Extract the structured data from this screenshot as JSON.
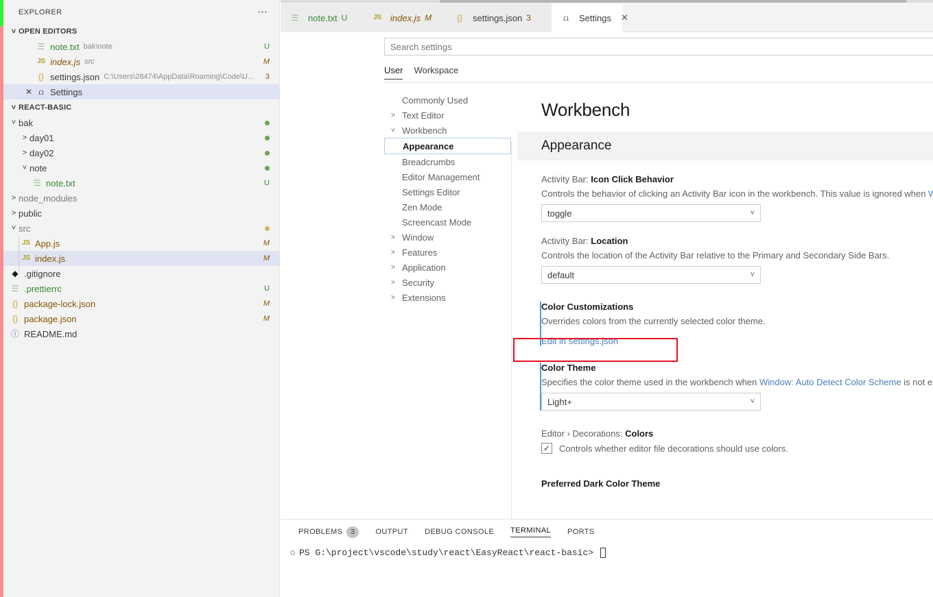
{
  "sidebar": {
    "title": "EXPLORER",
    "more_icon": "ellipsis-icon",
    "open_editors": {
      "label": "OPEN EDITORS",
      "items": [
        {
          "icon": "text-file-icon",
          "name": "note.txt",
          "sub": "bak\\note",
          "badge": "U",
          "badge_kind": "u"
        },
        {
          "icon": "js-file-icon",
          "name": "index.js",
          "sub": "src",
          "badge": "M",
          "badge_kind": "m"
        },
        {
          "icon": "json-file-icon",
          "name": "settings.json",
          "sub": "C:\\Users\\28474\\AppData\\Roaming\\Code\\U...",
          "badge": "3",
          "badge_kind": "n"
        },
        {
          "icon": "settings-gear-icon",
          "name": "Settings",
          "sub": "",
          "badge": "",
          "badge_kind": ""
        }
      ]
    },
    "project": {
      "label": "REACT-BASIC",
      "items": [
        {
          "name": "bak",
          "kind": "folder",
          "expanded": true,
          "depth": 1,
          "decor": "dot-green"
        },
        {
          "name": "day01",
          "kind": "folder",
          "expanded": false,
          "depth": 2,
          "decor": "dot-green"
        },
        {
          "name": "day02",
          "kind": "folder",
          "expanded": false,
          "depth": 2,
          "decor": "dot-green"
        },
        {
          "name": "note",
          "kind": "folder",
          "expanded": true,
          "depth": 2,
          "decor": "dot-green"
        },
        {
          "name": "note.txt",
          "kind": "txt",
          "depth": 3,
          "badge": "U",
          "badge_kind": "u"
        },
        {
          "name": "node_modules",
          "kind": "folder",
          "expanded": false,
          "depth": 1,
          "dim": true
        },
        {
          "name": "public",
          "kind": "folder",
          "expanded": false,
          "depth": 1
        },
        {
          "name": "src",
          "kind": "folder",
          "expanded": true,
          "depth": 1,
          "decor": "dot-tan",
          "dim": true
        },
        {
          "name": "App.js",
          "kind": "js",
          "depth": 2,
          "badge": "M",
          "badge_kind": "m"
        },
        {
          "name": "index.js",
          "kind": "js",
          "depth": 2,
          "badge": "M",
          "badge_kind": "m",
          "selected": true
        },
        {
          "name": ".gitignore",
          "kind": "git",
          "depth": 1
        },
        {
          "name": ".prettierrc",
          "kind": "txt",
          "depth": 1,
          "badge": "U",
          "badge_kind": "u"
        },
        {
          "name": "package-lock.json",
          "kind": "json",
          "depth": 1,
          "badge": "M",
          "badge_kind": "m"
        },
        {
          "name": "package.json",
          "kind": "json",
          "depth": 1,
          "badge": "M",
          "badge_kind": "m"
        },
        {
          "name": "README.md",
          "kind": "md",
          "depth": 1
        }
      ]
    }
  },
  "tabs": [
    {
      "icon": "text-file-icon",
      "label": "note.txt",
      "badge": "U",
      "badge_kind": "u",
      "active": false
    },
    {
      "icon": "js-file-icon",
      "label": "index.js",
      "badge": "M",
      "badge_kind": "m",
      "active": false
    },
    {
      "icon": "json-file-icon",
      "label": "settings.json",
      "badge": "3",
      "badge_kind": "n",
      "active": false
    },
    {
      "icon": "settings-gear-icon",
      "label": "Settings",
      "badge": "",
      "badge_kind": "",
      "active": true,
      "close_icon": "close-icon"
    }
  ],
  "settings_editor": {
    "search": {
      "placeholder": "Search settings",
      "value": ""
    },
    "scope_tabs": [
      {
        "label": "User",
        "active": true
      },
      {
        "label": "Workspace",
        "active": false
      }
    ],
    "toc": [
      {
        "label": "Commonly Used",
        "chevron": "",
        "depth": 1
      },
      {
        "label": "Text Editor",
        "chevron": "chevron-right-icon",
        "depth": 0
      },
      {
        "label": "Workbench",
        "chevron": "chevron-down-icon",
        "depth": 0
      },
      {
        "label": "Appearance",
        "chevron": "",
        "depth": 1,
        "active": true
      },
      {
        "label": "Breadcrumbs",
        "chevron": "",
        "depth": 1
      },
      {
        "label": "Editor Management",
        "chevron": "",
        "depth": 1
      },
      {
        "label": "Settings Editor",
        "chevron": "",
        "depth": 1
      },
      {
        "label": "Zen Mode",
        "chevron": "",
        "depth": 1
      },
      {
        "label": "Screencast Mode",
        "chevron": "",
        "depth": 1
      },
      {
        "label": "Window",
        "chevron": "chevron-right-icon",
        "depth": 0
      },
      {
        "label": "Features",
        "chevron": "chevron-right-icon",
        "depth": 0
      },
      {
        "label": "Application",
        "chevron": "chevron-right-icon",
        "depth": 0
      },
      {
        "label": "Security",
        "chevron": "chevron-right-icon",
        "depth": 0
      },
      {
        "label": "Extensions",
        "chevron": "chevron-right-icon",
        "depth": 0
      }
    ],
    "page_title": "Workbench",
    "group_title": "Appearance",
    "items": {
      "activity_bar_icon_click": {
        "title_prefix": "Activity Bar: ",
        "title_key": "Icon Click Behavior",
        "description": "Controls the behavior of clicking an Activity Bar icon in the workbench. This value is ignored when ",
        "description_link": "Wo",
        "value": "toggle",
        "caret": "chevron-down-icon"
      },
      "activity_bar_location": {
        "title_prefix": "Activity Bar: ",
        "title_key": "Location",
        "description": "Controls the location of the Activity Bar relative to the Primary and Secondary Side Bars.",
        "value": "default",
        "caret": "chevron-down-icon"
      },
      "color_customizations": {
        "title": "Color Customizations",
        "description": "Overrides colors from the currently selected color theme.",
        "link": "Edit in settings.json"
      },
      "color_theme": {
        "title": "Color Theme",
        "description_before": "Specifies the color theme used in the workbench when ",
        "description_link": "Window: Auto Detect Color Scheme",
        "description_after": " is not ena",
        "value": "Light+",
        "caret": "chevron-down-icon"
      },
      "editor_decorations_colors": {
        "title_prefix": "Editor › Decorations: ",
        "title_key": "Colors",
        "checkbox_checked": true,
        "check_icon": "checkmark-icon",
        "label": "Controls whether editor file decorations should use colors."
      },
      "preferred_dark_theme": {
        "title": "Preferred Dark Color Theme"
      }
    }
  },
  "panel": {
    "tabs": [
      {
        "label": "PROBLEMS",
        "count": "3",
        "active": false
      },
      {
        "label": "OUTPUT",
        "count": "",
        "active": false
      },
      {
        "label": "DEBUG CONSOLE",
        "count": "",
        "active": false
      },
      {
        "label": "TERMINAL",
        "count": "",
        "active": true
      },
      {
        "label": "PORTS",
        "count": "",
        "active": false
      }
    ],
    "terminal_prompt": "PS G:\\project\\vscode\\study\\react\\EasyReact\\react-basic>"
  },
  "colors": {
    "accent_blue": "#4a7ebb",
    "highlight_red": "#e81123",
    "modified_bar": "#4a9ee0",
    "git_added": "#388a34",
    "git_modified": "#895503",
    "strip_green": "#35f135",
    "strip_salmon": "#f78d8d"
  }
}
